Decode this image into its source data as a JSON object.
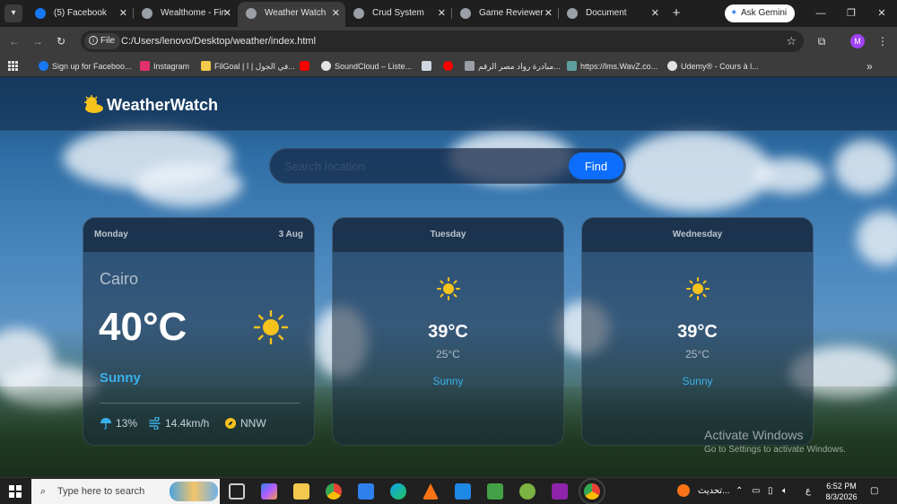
{
  "browser": {
    "tabs": [
      {
        "title": "(5) Facebook",
        "active": false,
        "color": "#1877f2"
      },
      {
        "title": "Wealthome - Fin",
        "active": false,
        "color": "#9aa0a6"
      },
      {
        "title": "Weather Watch",
        "active": true,
        "color": "#9aa0a6"
      },
      {
        "title": "Crud System",
        "active": false,
        "color": "#9aa0a6"
      },
      {
        "title": "Game Reviewer",
        "active": false,
        "color": "#9aa0a6"
      },
      {
        "title": "Document",
        "active": false,
        "color": "#9aa0a6"
      }
    ],
    "ask_gemini": "Ask Gemini",
    "file_chip": "File",
    "url": "C:/Users/lenovo/Desktop/weather/index.html",
    "profile_initial": "M",
    "bookmarks": [
      {
        "label": "Sign up for Faceboo...",
        "color": "#1877f2"
      },
      {
        "label": "Instagram",
        "color": "#e1306c"
      },
      {
        "label": "FilGoal | في الجول | ا...",
        "color": "#f2c94c"
      },
      {
        "label": "",
        "color": "#ff0000"
      },
      {
        "label": "SoundCloud – Liste...",
        "color": "#e3e3e3"
      },
      {
        "label": "",
        "color": "#e3e3e3"
      },
      {
        "label": "",
        "color": "#ff0000"
      },
      {
        "label": "مبادرة رواد مصر الرقم...",
        "color": "#9aa0a6"
      },
      {
        "label": "https://lms.WavZ.co...",
        "color": "#5f9ea0"
      },
      {
        "label": "Udemy® - Cours à l...",
        "color": "#e3e3e3"
      }
    ]
  },
  "app": {
    "brand": "WeatherWatch",
    "search": {
      "placeholder": "Search location",
      "button": "Find"
    },
    "today": {
      "day": "Monday",
      "date": "3 Aug",
      "city": "Cairo",
      "temp": "40°C",
      "condition": "Sunny",
      "icon": "sun-icon",
      "humidity": "13%",
      "wind": "14.4km/h",
      "direction": "NNW"
    },
    "forecast": [
      {
        "day": "Tuesday",
        "icon": "sun-icon",
        "max": "39°C",
        "min": "25°C",
        "condition": "Sunny"
      },
      {
        "day": "Wednesday",
        "icon": "sun-icon",
        "max": "39°C",
        "min": "25°C",
        "condition": "Sunny"
      }
    ],
    "colors": {
      "accent": "#0d6efd",
      "condition": "#3ab0ea",
      "sun": "#f6c21c"
    }
  },
  "watermark": {
    "line1": "Activate Windows",
    "line2": "Go to Settings to activate Windows."
  },
  "taskbar": {
    "search_placeholder": "Type here to search",
    "tray_text": "تحديث...",
    "lang": "ع",
    "time": "6:52 PM",
    "date": "8/3/2026"
  }
}
